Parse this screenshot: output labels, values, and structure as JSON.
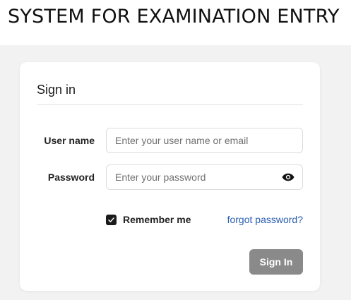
{
  "header": {
    "title": "SYSTEM FOR EXAMINATION ENTRY"
  },
  "login_card": {
    "title": "Sign in",
    "username": {
      "label": "User name",
      "value": "",
      "placeholder": "Enter your user name or email"
    },
    "password": {
      "label": "Password",
      "value": "",
      "placeholder": "Enter your password",
      "toggle_icon": "eye-icon"
    },
    "remember_me": {
      "label": "Remember me",
      "checked": true
    },
    "forgot_password_label": "forgot password?",
    "submit_label": "Sign In"
  },
  "colors": {
    "backdrop": "#f2f2f2",
    "link": "#2a5db0",
    "button_disabled": "#8a8a8a",
    "checkbox": "#1a1a1a"
  }
}
